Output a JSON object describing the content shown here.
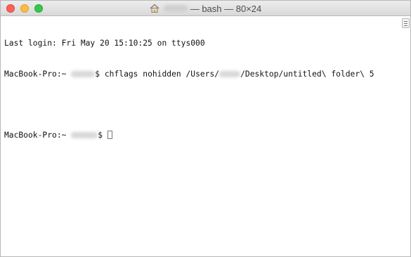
{
  "window": {
    "title_suffix": "— bash — 80×24",
    "home_icon": "home-icon",
    "traffic_lights": [
      "close",
      "minimize",
      "zoom"
    ]
  },
  "terminal": {
    "lines": [
      {
        "text": "Last login: Fri May 20 15:10:25 on ttys000"
      },
      {
        "host": "MacBook-Pro:~",
        "prompt": "$",
        "command_before": "chflags nohidden /Users/",
        "command_after": "/Desktop/untitled\\ folder\\ 5"
      },
      {
        "text": ""
      },
      {
        "host": "MacBook-Pro:~",
        "prompt": "$"
      }
    ]
  }
}
